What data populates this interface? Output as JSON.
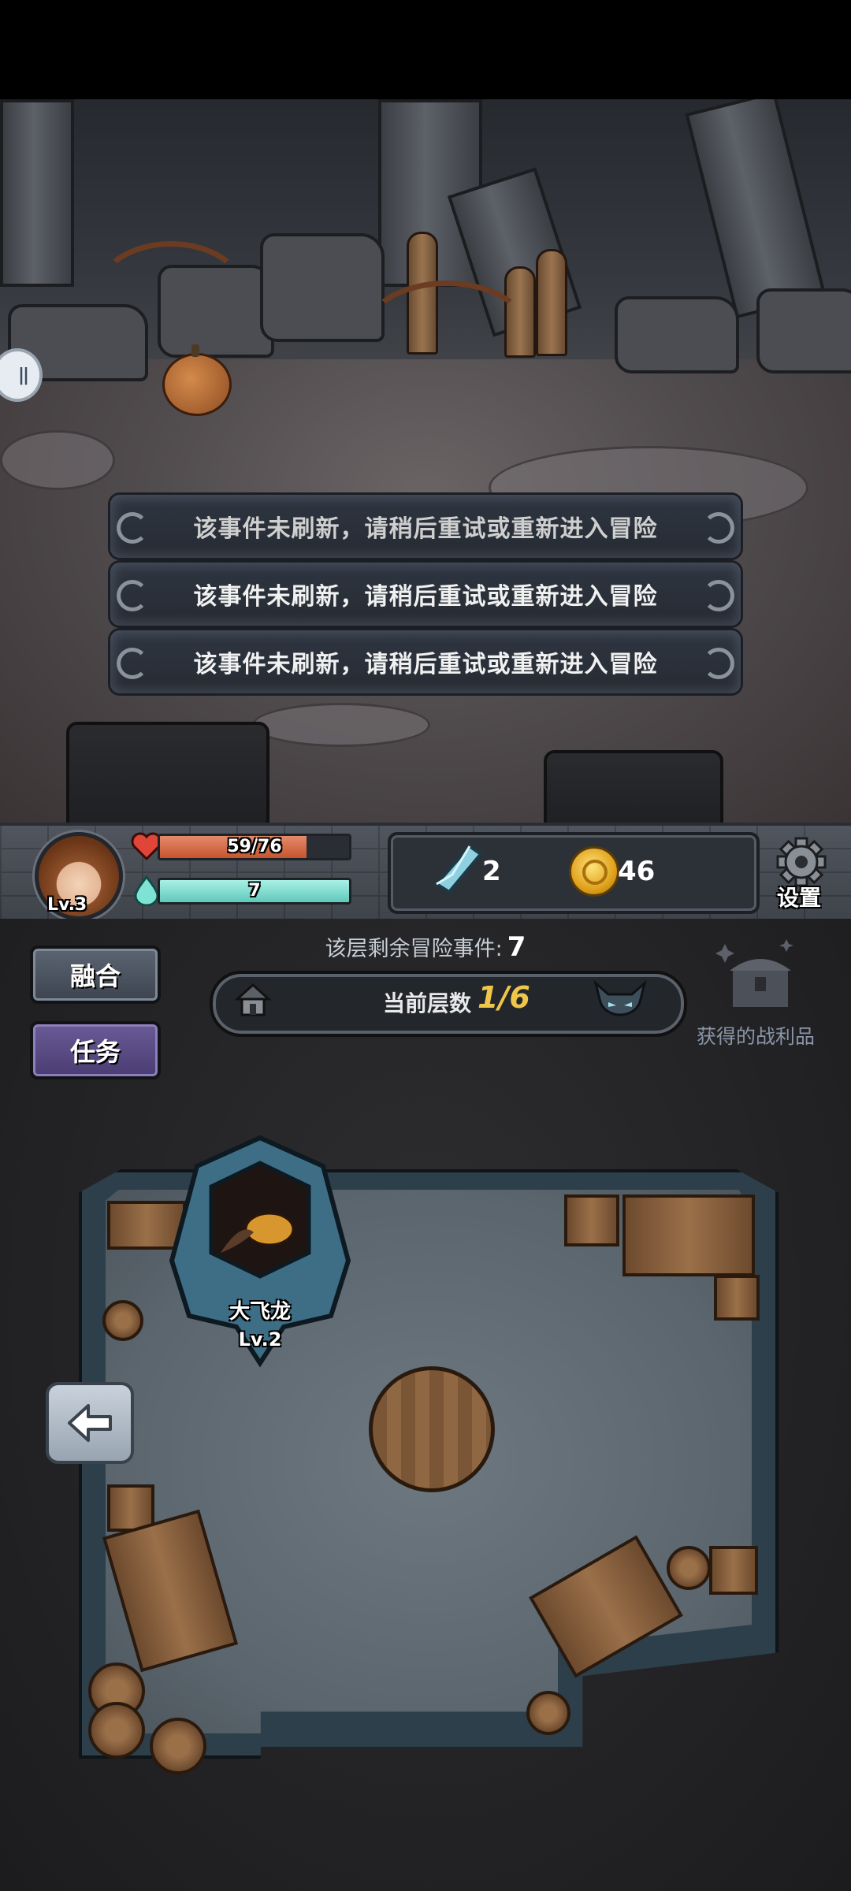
{
  "event": {
    "options": [
      "该事件未刷新，请稍后重试或重新进入冒险",
      "该事件未刷新，请稍后重试或重新进入冒险",
      "该事件未刷新，请稍后重试或重新进入冒险"
    ]
  },
  "player": {
    "level": "Lv.3",
    "hp_text": "59/76",
    "hp_fraction": 0.776,
    "mp_text": "7",
    "mp_fraction": 1.0
  },
  "resources": {
    "crystal_count": "2",
    "coin_count": "46"
  },
  "settings_label": "设置",
  "side_buttons": {
    "fusion": "融合",
    "quest": "任务"
  },
  "floor": {
    "remaining_label": "该层剩余冒险事件:",
    "remaining_count": "7",
    "current_label": "当前层数",
    "current_value": "1/6"
  },
  "loot_label": "获得的战利品",
  "monster": {
    "name": "大飞龙",
    "level": "Lv.2"
  },
  "icons": [
    "pause-icon",
    "heart-icon",
    "mana-drop-icon",
    "crystal-icon",
    "coin-icon",
    "gear-icon",
    "house-icon",
    "boss-icon",
    "treasure-chest-icon",
    "back-arrow-icon"
  ]
}
